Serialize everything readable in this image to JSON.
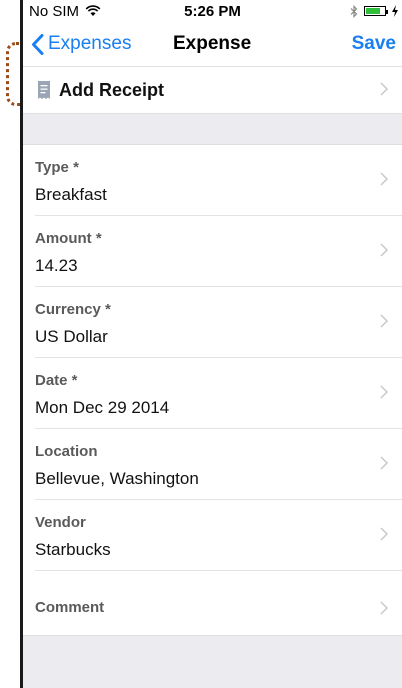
{
  "status_bar": {
    "carrier": "No SIM",
    "time": "5:26 PM",
    "icons": [
      "wifi-icon",
      "bluetooth-icon",
      "battery-icon",
      "charging-icon"
    ]
  },
  "nav": {
    "back_label": "Expenses",
    "title": "Expense",
    "save_label": "Save",
    "accent_color": "#1a7ff0"
  },
  "receipt": {
    "label": "Add Receipt",
    "icon": "receipt-icon"
  },
  "fields": [
    {
      "label": "Type *",
      "value": "Breakfast"
    },
    {
      "label": "Amount *",
      "value": "14.23"
    },
    {
      "label": "Currency *",
      "value": "US Dollar"
    },
    {
      "label": "Date *",
      "value": "Mon Dec 29 2014"
    },
    {
      "label": "Location",
      "value": "Bellevue, Washington"
    },
    {
      "label": "Vendor",
      "value": "Starbucks"
    }
  ],
  "comment": {
    "label": "Comment"
  },
  "annotation": {
    "color": "#9b4a1a"
  }
}
